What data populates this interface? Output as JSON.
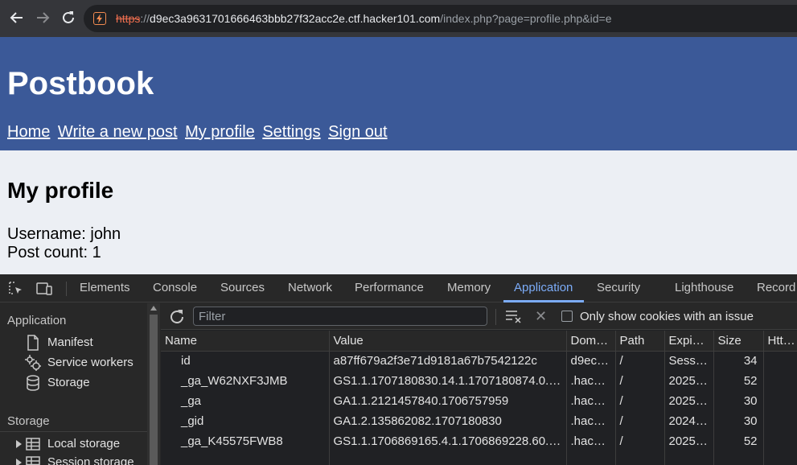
{
  "browser": {
    "url_scheme": "https",
    "url_sep": "://",
    "url_host": "d9ec3a9631701666463bbb27f32acc2e.ctf.hacker101.com",
    "url_path": "/index.php?page=profile.php&id=e"
  },
  "site": {
    "title": "Postbook",
    "nav": [
      "Home",
      "Write a new post",
      "My profile",
      "Settings",
      "Sign out"
    ]
  },
  "profile": {
    "heading": "My profile",
    "username_line": "Username: john",
    "post_count_line": "Post count: 1"
  },
  "devtools": {
    "tabs": [
      "Elements",
      "Console",
      "Sources",
      "Network",
      "Performance",
      "Memory",
      "Application",
      "Security",
      "Lighthouse",
      "Record"
    ],
    "active_tab": "Application",
    "sidebar": {
      "application_heading": "Application",
      "application_items": [
        "Manifest",
        "Service workers",
        "Storage"
      ],
      "storage_heading": "Storage",
      "storage_items": [
        "Local storage",
        "Session storage"
      ]
    },
    "filter_placeholder": "Filter",
    "issue_checkbox_label": "Only show cookies with an issue",
    "columns": [
      "Name",
      "Value",
      "Dom…",
      "Path",
      "Expi…",
      "Size",
      "Http…"
    ],
    "cookies": [
      {
        "name": "id",
        "value": "a87ff679a2f3e71d9181a67b7542122c",
        "domain": "d9ec…",
        "path": "/",
        "expires": "Sess…",
        "size": "34",
        "http": ""
      },
      {
        "name": "_ga_W62NXF3JMB",
        "value": "GS1.1.1707180830.14.1.1707180874.0.…",
        "domain": ".hac…",
        "path": "/",
        "expires": "2025…",
        "size": "52",
        "http": ""
      },
      {
        "name": "_ga",
        "value": "GA1.1.2121457840.1706757959",
        "domain": ".hac…",
        "path": "/",
        "expires": "2025…",
        "size": "30",
        "http": ""
      },
      {
        "name": "_gid",
        "value": "GA1.2.135862082.1707180830",
        "domain": ".hac…",
        "path": "/",
        "expires": "2024…",
        "size": "30",
        "http": ""
      },
      {
        "name": "_ga_K45575FWB8",
        "value": "GS1.1.1706869165.4.1.1706869228.60.…",
        "domain": ".hac…",
        "path": "/",
        "expires": "2025…",
        "size": "52",
        "http": ""
      }
    ]
  }
}
